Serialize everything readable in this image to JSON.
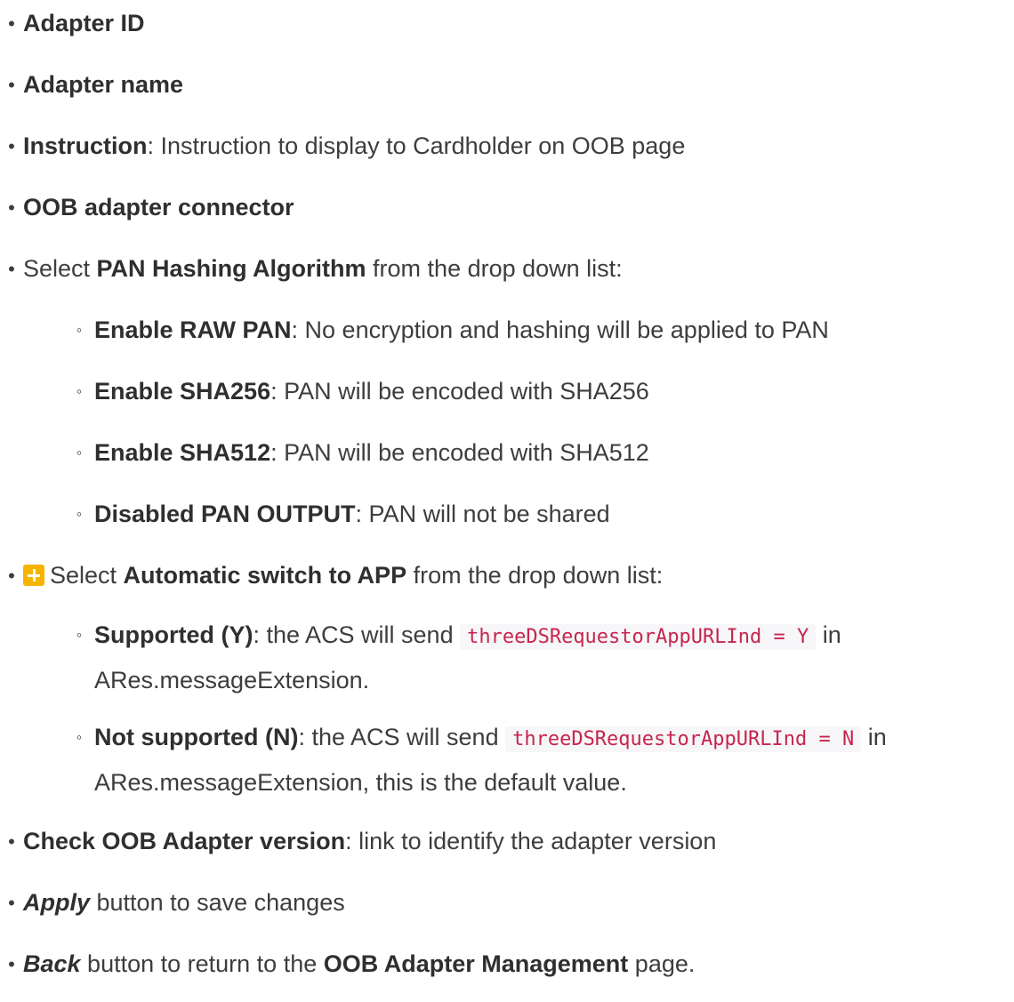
{
  "items": {
    "adapter_id": {
      "label": "Adapter ID"
    },
    "adapter_name": {
      "label": "Adapter name"
    },
    "instruction": {
      "label": "Instruction",
      "text": ": Instruction to display to Cardholder on OOB page"
    },
    "connector": {
      "label": "OOB adapter connector"
    },
    "pan_hashing": {
      "prefix": "Select ",
      "label": "PAN Hashing Algorithm",
      "suffix": " from the drop down list:",
      "options": [
        {
          "label": "Enable RAW PAN",
          "text": ": No encryption and hashing will be applied to PAN"
        },
        {
          "label": "Enable SHA256",
          "text": ": PAN will be encoded with SHA256"
        },
        {
          "label": "Enable SHA512",
          "text": ": PAN will be encoded with SHA512"
        },
        {
          "label": "Disabled PAN OUTPUT",
          "text": ": PAN will not be shared"
        }
      ]
    },
    "auto_switch": {
      "icon": "plus-icon",
      "prefix": "Select ",
      "label": "Automatic switch to APP",
      "suffix": " from the drop down list:",
      "options": [
        {
          "label": "Supported (Y)",
          "text_before": ": the ACS will send ",
          "code": "threeDSRequestorAppURLInd = Y",
          "text_after": " in ARes.messageExtension."
        },
        {
          "label": "Not supported (N)",
          "text_before": ": the ACS will send ",
          "code": "threeDSRequestorAppURLInd = N",
          "text_after": " in ARes.messageExtension, this is the default value."
        }
      ]
    },
    "check_version": {
      "label": "Check OOB Adapter version",
      "text": ": link to identify the adapter version"
    },
    "apply": {
      "label": "Apply",
      "text": " button to save changes"
    },
    "back": {
      "label": "Back",
      "text": " button to return to the ",
      "page": "OOB Adapter Management",
      "text_end": " page."
    }
  }
}
